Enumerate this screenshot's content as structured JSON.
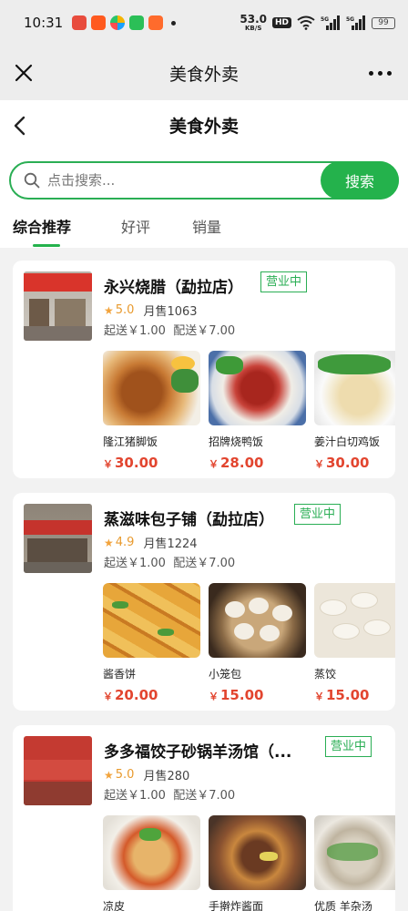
{
  "status_bar": {
    "time": "10:31",
    "net_speed": "53.0",
    "net_unit": "KB/S",
    "hd": "HD",
    "sig1": "5G",
    "sig2": "5G",
    "battery": "99"
  },
  "miniprogram": {
    "title": "美食外卖"
  },
  "page": {
    "title": "美食外卖",
    "search": {
      "placeholder": "点击搜索...",
      "button": "搜索"
    },
    "tabs": [
      "综合推荐",
      "好评",
      "销量"
    ]
  },
  "stores": [
    {
      "name": "永兴烧腊（勐拉店）",
      "status": "营业中",
      "rating": "5.0",
      "monthly_sales": "月售1063",
      "min_order": "起送￥1.00",
      "delivery_fee": "配送￥7.00",
      "dishes": [
        {
          "name": "隆江猪脚饭",
          "price": "30.00"
        },
        {
          "name": "招牌烧鸭饭",
          "price": "28.00"
        },
        {
          "name": "姜汁白切鸡饭",
          "price": "30.00"
        }
      ]
    },
    {
      "name": "蒸滋味包子铺（勐拉店）",
      "status": "营业中",
      "rating": "4.9",
      "monthly_sales": "月售1224",
      "min_order": "起送￥1.00",
      "delivery_fee": "配送￥7.00",
      "dishes": [
        {
          "name": "酱香饼",
          "price": "20.00"
        },
        {
          "name": "小笼包",
          "price": "15.00"
        },
        {
          "name": "蒸饺",
          "price": "15.00"
        }
      ]
    },
    {
      "name": "多多福饺子砂锅羊汤馆（...",
      "status": "营业中",
      "rating": "5.0",
      "monthly_sales": "月售280",
      "min_order": "起送￥1.00",
      "delivery_fee": "配送￥7.00",
      "dishes": [
        {
          "name": "凉皮",
          "price": ""
        },
        {
          "name": "手擀炸酱面",
          "price": ""
        },
        {
          "name": "优质 羊杂汤",
          "price": ""
        }
      ]
    }
  ],
  "currency_symbol": "￥",
  "colors": {
    "accent": "#24b24c",
    "price": "#e2452f",
    "rating": "#e89a2e"
  }
}
